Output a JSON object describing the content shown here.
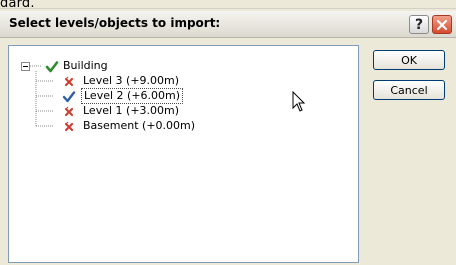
{
  "top_fragment": "dard.",
  "dialog": {
    "title": "Select levels/objects to import:",
    "help_symbol": "?",
    "buttons": {
      "ok": "OK",
      "cancel": "Cancel"
    }
  },
  "tree": {
    "root": {
      "label": "Building",
      "icon": "check-icon"
    },
    "items": [
      {
        "label": "Level 3 (+9.00m)",
        "icon": "x-mark-icon",
        "selected": false
      },
      {
        "label": "Level 2 (+6.00m)",
        "icon": "check-icon",
        "selected": true
      },
      {
        "label": "Level 1 (+3.00m)",
        "icon": "x-mark-icon",
        "selected": false
      },
      {
        "label": "Basement (+0.00m)",
        "icon": "x-mark-icon",
        "selected": false
      }
    ]
  },
  "colors": {
    "accent": "#003c74",
    "tree_border": "#7f9db9",
    "check_green": "#2e8b2e",
    "x_red": "#d43b2e",
    "close_red": "#d64a2e",
    "background": "#ece9d8"
  }
}
